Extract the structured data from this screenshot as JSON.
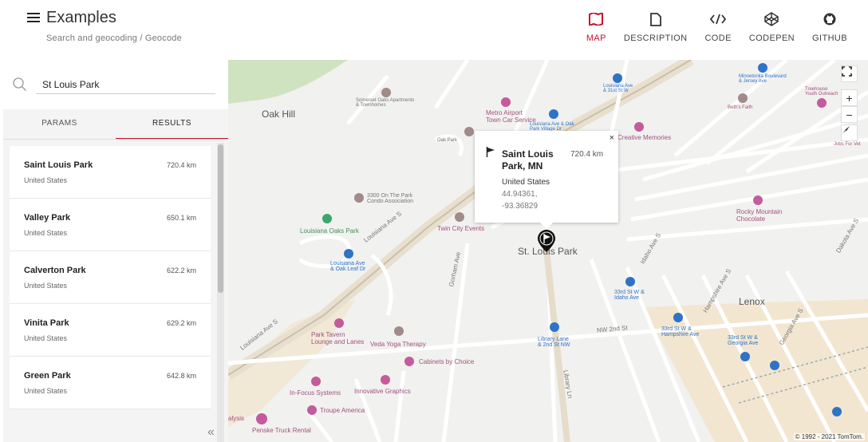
{
  "app": {
    "title": "Examples",
    "breadcrumb": "Search and geocoding / Geocode"
  },
  "nav": [
    {
      "label": "MAP",
      "icon": "map-icon",
      "active": true
    },
    {
      "label": "DESCRIPTION",
      "icon": "document-icon",
      "active": false
    },
    {
      "label": "CODE",
      "icon": "code-icon",
      "active": false
    },
    {
      "label": "CODEPEN",
      "icon": "codepen-icon",
      "active": false
    },
    {
      "label": "GITHUB",
      "icon": "github-icon",
      "active": false
    }
  ],
  "search": {
    "value": "St Louis Park",
    "icon": "search-icon"
  },
  "tabs": [
    {
      "label": "PARAMS",
      "active": false
    },
    {
      "label": "RESULTS",
      "active": true
    }
  ],
  "results": [
    {
      "name": "Saint Louis Park",
      "country": "United States",
      "distance": "720.4 km"
    },
    {
      "name": "Valley Park",
      "country": "United States",
      "distance": "650.1 km"
    },
    {
      "name": "Calverton Park",
      "country": "United States",
      "distance": "622.2 km"
    },
    {
      "name": "Vinita Park",
      "country": "United States",
      "distance": "629.2 km"
    },
    {
      "name": "Green Park",
      "country": "United States",
      "distance": "642.8 km"
    }
  ],
  "collapse_label": "«",
  "popup": {
    "close": "×",
    "name": "Saint Louis Park, MN",
    "distance": "720.4 km",
    "country": "United States",
    "lat": "44.94361,",
    "lon": "-93.36829"
  },
  "map": {
    "labels": {
      "oak_hill": "Oak Hill",
      "st_louis_park": "St. Louis Park",
      "lenox": "Lenox",
      "louisiana_oaks_park": "Louisiana Oaks Park",
      "twin_city_events": "Twin City Events",
      "park_tavern": "Park Tavern\nLounge and Lanes",
      "veda_yoga": "Veda Yoga Therapy",
      "cabinets_by_choice": "Cabinets by Choice",
      "innovative_graphics": "Innovative Graphics",
      "in_focus_systems": "In-Focus Systems",
      "troupe_america": "Troupe America",
      "penske": "Penske Truck Rental",
      "rocky_mountain": "Rocky Mountain\nChocolate",
      "creative_memories": "Creative Memories",
      "metro_airport": "Metro Airport\nTown Car Service",
      "somerset_oaks": "Somerset Oaks Apartments\n& Townhomes",
      "park_condo": "3300 On The Park\nCondo Association",
      "louisiana_ave_oak_leaf": "Louisiana Ave\n& Oak Leaf Dr",
      "library_lane": "Library Lane\n& 2nd St NW",
      "33rd_idaho": "33rd St W &\nIdaho Ave",
      "33rd_hampshire": "33rd St W &\nHampshire Ave",
      "33rd_georgia": "33rd St W &\nGeorgia Ave",
      "beths_faith": "Beth's Faith",
      "minnetonka": "Minnetonka Boulevard\n& Jersey Ave",
      "treehouse": "Treehouse\nYouth Outreach",
      "jobs_for_vets": "Jobs For Vet",
      "louisiana_31st": "Louisiana Ave\n& 31st St W",
      "louisiana_oak_park": "Louisiana Ave & Oak\nPark Village Dr",
      "louisiana_ave": "Louisiana Ave S",
      "louisiana_ave_2": "Louisiana Ave S",
      "gorham_ave": "Gorham Ave",
      "library_ln": "Library Ln",
      "nw_2nd_st": "NW 2nd St",
      "idaho_ave": "Idaho Ave S",
      "hampshire_ave": "Hampshire Ave S",
      "georgia_ave": "Georgia Ave S",
      "alysis": "alysis",
      "oak_park": "Oak Park",
      "dakota_ave": "Dakota Ave S"
    },
    "controls": {
      "fullscreen": "fullscreen-icon",
      "zoom_in": "+",
      "zoom_out": "−",
      "compass": "compass-icon"
    },
    "copyright": "© 1992 - 2021 TomTom."
  },
  "colors": {
    "accent": "#c8102e",
    "park": "#cfe3c1",
    "commercial": "#f3e6d0",
    "poi": "#c45b9a",
    "transit": "#2f73c7"
  }
}
